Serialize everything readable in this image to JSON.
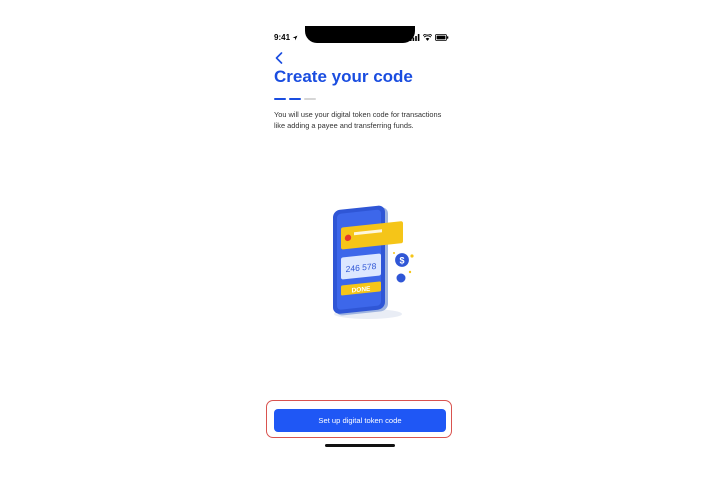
{
  "status_bar": {
    "time": "9:41",
    "icons": [
      "location-arrow-icon",
      "signal-icon",
      "wifi-icon",
      "battery-icon"
    ]
  },
  "nav": {
    "back_icon": "chevron-left-icon"
  },
  "page": {
    "title": "Create your code",
    "description": "You will use your digital token code for transactions like adding a payee and transferring funds.",
    "progress": {
      "total_steps": 3,
      "completed_steps": 2
    }
  },
  "illustration": {
    "code": "246 578",
    "button_label": "DONE"
  },
  "cta": {
    "label": "Set up digital token code"
  },
  "colors": {
    "accent": "#1a4de0",
    "button": "#1f57f5",
    "highlight": "#d9534f",
    "illustration_yellow": "#f5c518",
    "progress_inactive": "#d6d6d6"
  }
}
